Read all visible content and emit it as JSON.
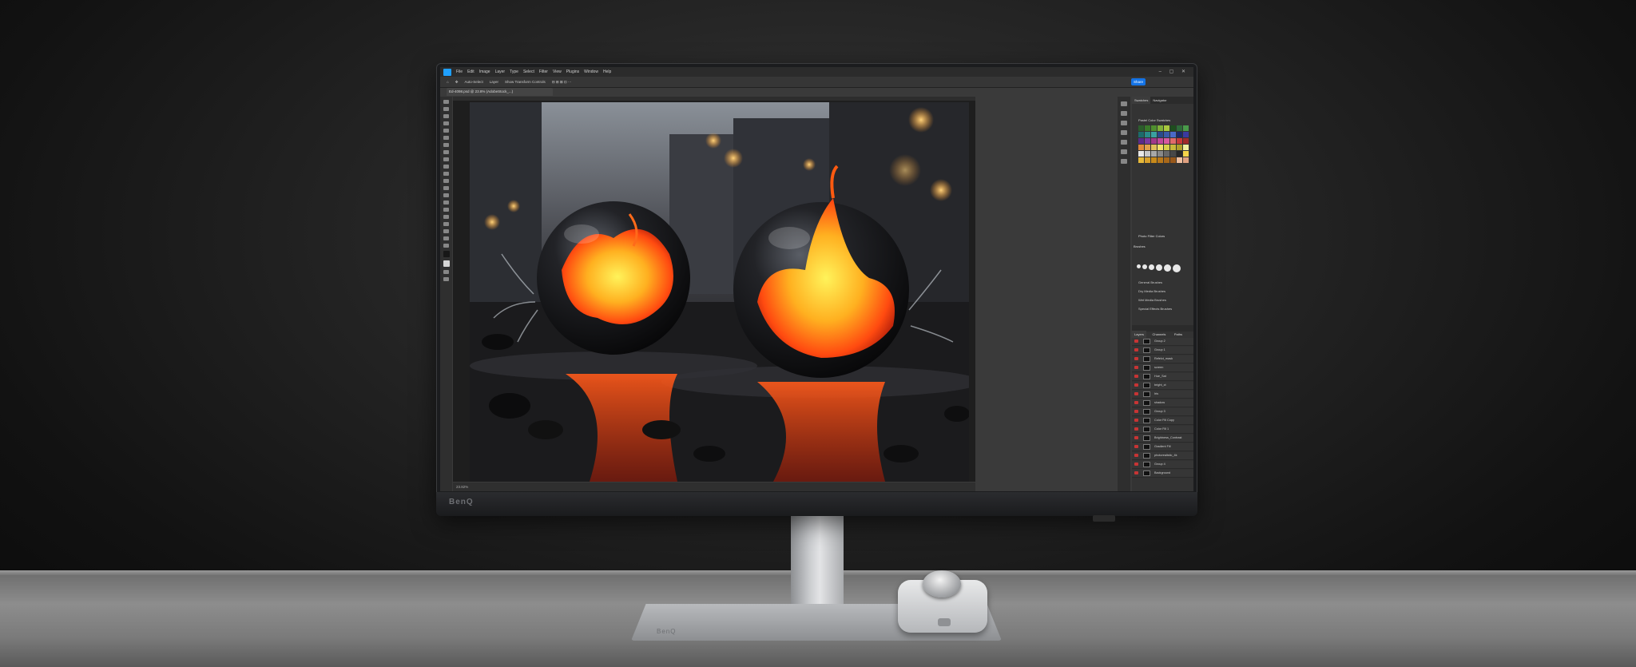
{
  "monitor": {
    "brand": "BenQ",
    "stand_brand": "BenQ"
  },
  "photoshop": {
    "menu": [
      "File",
      "Edit",
      "Image",
      "Layer",
      "Type",
      "Select",
      "Filter",
      "View",
      "Plugins",
      "Window",
      "Help"
    ],
    "window_controls": "– ▢ ✕",
    "options_bar": {
      "auto_select": "Auto-Select",
      "layer_mode": "Layer",
      "show_transform": "Show Transform Controls"
    },
    "share_button": "Share",
    "document_tab": "Ed-4098.psd @ 23.8% (AdobeStock_...)",
    "status_bar": "23.82%",
    "panels": {
      "swatches_tab": "Swatches",
      "navigator_tab": "Navigator",
      "swatch_group_1": "Pastel Color Swatches",
      "swatch_group_2": "Photo Filter Colors",
      "brushes_title": "Brushes",
      "brush_folders": [
        "General Brushes",
        "Dry Media Brushes",
        "Wet Media Brushes",
        "Special Effects Brushes"
      ],
      "layers_tabs": [
        "Layers",
        "Channels",
        "Paths"
      ],
      "layers": [
        "Group 2",
        "Group 1",
        "Refelct_mask",
        "screen",
        "Hue_Sat",
        "bright_ct",
        "Iris",
        "shadow",
        "Group 3",
        "Color Fill Copy",
        "Color Fill 1",
        "Brightness_Contrast",
        "Gradient Fill",
        "photorealistic_4k",
        "Group 4",
        "Background"
      ]
    },
    "swatch_colors": [
      "#2b5e2b",
      "#3a7a2a",
      "#4f8f2f",
      "#7fb03a",
      "#a8c83e",
      "#1e4d1e",
      "#2e6b3a",
      "#4a9a4a",
      "#1c6b6b",
      "#2a8a8a",
      "#3aa0a0",
      "#2a4a8a",
      "#3a5aa8",
      "#4a6ac8",
      "#1a2a6a",
      "#3a3aa0",
      "#5a2a8a",
      "#7a3aa0",
      "#a03a8a",
      "#c04a9a",
      "#d85aa0",
      "#e06a6a",
      "#c83a3a",
      "#a02a2a",
      "#e08a3a",
      "#e0a04a",
      "#e0c05a",
      "#f0e06a",
      "#d8d04a",
      "#c8b83a",
      "#b0a02a",
      "#f0f0a0",
      "#e8e8e8",
      "#c8c8c8",
      "#a8a8a8",
      "#888888",
      "#686868",
      "#484848",
      "#282828",
      "#f4d44a",
      "#e6b93a",
      "#d8a02a",
      "#c88a1a",
      "#b8781a",
      "#a8681a",
      "#98581a",
      "#f0c0a0",
      "#e0a080"
    ]
  }
}
